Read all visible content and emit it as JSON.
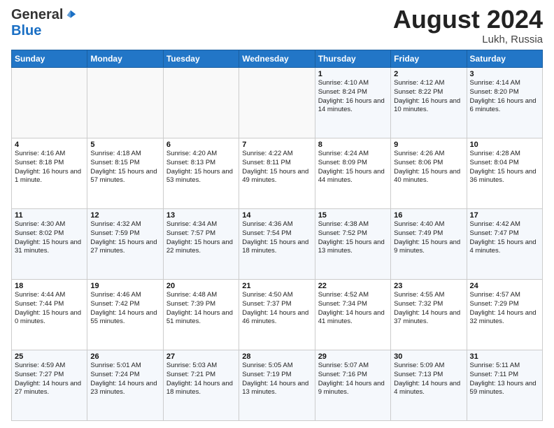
{
  "logo": {
    "general": "General",
    "blue": "Blue"
  },
  "title": {
    "month_year": "August 2024",
    "location": "Lukh, Russia"
  },
  "weekdays": [
    "Sunday",
    "Monday",
    "Tuesday",
    "Wednesday",
    "Thursday",
    "Friday",
    "Saturday"
  ],
  "weeks": [
    [
      {
        "day": "",
        "info": ""
      },
      {
        "day": "",
        "info": ""
      },
      {
        "day": "",
        "info": ""
      },
      {
        "day": "",
        "info": ""
      },
      {
        "day": "1",
        "info": "Sunrise: 4:10 AM\nSunset: 8:24 PM\nDaylight: 16 hours and 14 minutes."
      },
      {
        "day": "2",
        "info": "Sunrise: 4:12 AM\nSunset: 8:22 PM\nDaylight: 16 hours and 10 minutes."
      },
      {
        "day": "3",
        "info": "Sunrise: 4:14 AM\nSunset: 8:20 PM\nDaylight: 16 hours and 6 minutes."
      }
    ],
    [
      {
        "day": "4",
        "info": "Sunrise: 4:16 AM\nSunset: 8:18 PM\nDaylight: 16 hours and 1 minute."
      },
      {
        "day": "5",
        "info": "Sunrise: 4:18 AM\nSunset: 8:15 PM\nDaylight: 15 hours and 57 minutes."
      },
      {
        "day": "6",
        "info": "Sunrise: 4:20 AM\nSunset: 8:13 PM\nDaylight: 15 hours and 53 minutes."
      },
      {
        "day": "7",
        "info": "Sunrise: 4:22 AM\nSunset: 8:11 PM\nDaylight: 15 hours and 49 minutes."
      },
      {
        "day": "8",
        "info": "Sunrise: 4:24 AM\nSunset: 8:09 PM\nDaylight: 15 hours and 44 minutes."
      },
      {
        "day": "9",
        "info": "Sunrise: 4:26 AM\nSunset: 8:06 PM\nDaylight: 15 hours and 40 minutes."
      },
      {
        "day": "10",
        "info": "Sunrise: 4:28 AM\nSunset: 8:04 PM\nDaylight: 15 hours and 36 minutes."
      }
    ],
    [
      {
        "day": "11",
        "info": "Sunrise: 4:30 AM\nSunset: 8:02 PM\nDaylight: 15 hours and 31 minutes."
      },
      {
        "day": "12",
        "info": "Sunrise: 4:32 AM\nSunset: 7:59 PM\nDaylight: 15 hours and 27 minutes."
      },
      {
        "day": "13",
        "info": "Sunrise: 4:34 AM\nSunset: 7:57 PM\nDaylight: 15 hours and 22 minutes."
      },
      {
        "day": "14",
        "info": "Sunrise: 4:36 AM\nSunset: 7:54 PM\nDaylight: 15 hours and 18 minutes."
      },
      {
        "day": "15",
        "info": "Sunrise: 4:38 AM\nSunset: 7:52 PM\nDaylight: 15 hours and 13 minutes."
      },
      {
        "day": "16",
        "info": "Sunrise: 4:40 AM\nSunset: 7:49 PM\nDaylight: 15 hours and 9 minutes."
      },
      {
        "day": "17",
        "info": "Sunrise: 4:42 AM\nSunset: 7:47 PM\nDaylight: 15 hours and 4 minutes."
      }
    ],
    [
      {
        "day": "18",
        "info": "Sunrise: 4:44 AM\nSunset: 7:44 PM\nDaylight: 15 hours and 0 minutes."
      },
      {
        "day": "19",
        "info": "Sunrise: 4:46 AM\nSunset: 7:42 PM\nDaylight: 14 hours and 55 minutes."
      },
      {
        "day": "20",
        "info": "Sunrise: 4:48 AM\nSunset: 7:39 PM\nDaylight: 14 hours and 51 minutes."
      },
      {
        "day": "21",
        "info": "Sunrise: 4:50 AM\nSunset: 7:37 PM\nDaylight: 14 hours and 46 minutes."
      },
      {
        "day": "22",
        "info": "Sunrise: 4:52 AM\nSunset: 7:34 PM\nDaylight: 14 hours and 41 minutes."
      },
      {
        "day": "23",
        "info": "Sunrise: 4:55 AM\nSunset: 7:32 PM\nDaylight: 14 hours and 37 minutes."
      },
      {
        "day": "24",
        "info": "Sunrise: 4:57 AM\nSunset: 7:29 PM\nDaylight: 14 hours and 32 minutes."
      }
    ],
    [
      {
        "day": "25",
        "info": "Sunrise: 4:59 AM\nSunset: 7:27 PM\nDaylight: 14 hours and 27 minutes."
      },
      {
        "day": "26",
        "info": "Sunrise: 5:01 AM\nSunset: 7:24 PM\nDaylight: 14 hours and 23 minutes."
      },
      {
        "day": "27",
        "info": "Sunrise: 5:03 AM\nSunset: 7:21 PM\nDaylight: 14 hours and 18 minutes."
      },
      {
        "day": "28",
        "info": "Sunrise: 5:05 AM\nSunset: 7:19 PM\nDaylight: 14 hours and 13 minutes."
      },
      {
        "day": "29",
        "info": "Sunrise: 5:07 AM\nSunset: 7:16 PM\nDaylight: 14 hours and 9 minutes."
      },
      {
        "day": "30",
        "info": "Sunrise: 5:09 AM\nSunset: 7:13 PM\nDaylight: 14 hours and 4 minutes."
      },
      {
        "day": "31",
        "info": "Sunrise: 5:11 AM\nSunset: 7:11 PM\nDaylight: 13 hours and 59 minutes."
      }
    ]
  ]
}
